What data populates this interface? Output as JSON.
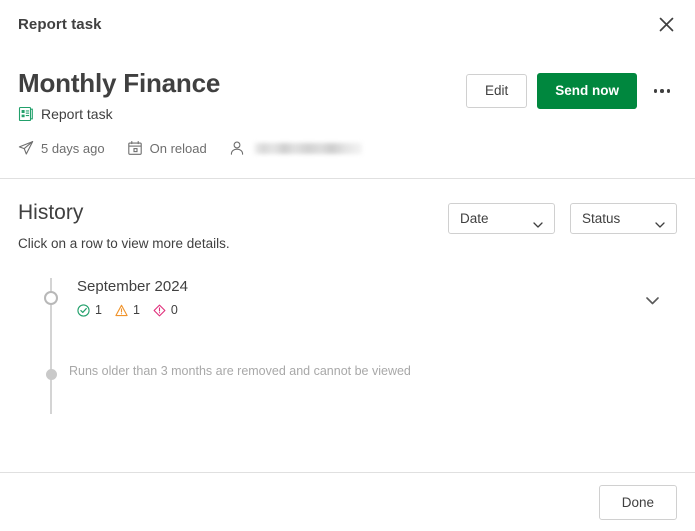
{
  "window": {
    "title": "Report task",
    "close_icon": "close-icon"
  },
  "header": {
    "title": "Monthly Finance",
    "subtitle": "Report task",
    "subtitle_icon": "report-task-icon",
    "meta": [
      {
        "icon": "send-icon",
        "label": "5 days ago"
      },
      {
        "icon": "calendar-icon",
        "label": "On reload"
      },
      {
        "icon": "person-icon",
        "label": ""
      }
    ],
    "actions": {
      "edit_label": "Edit",
      "send_now_label": "Send now",
      "more_icon": "more-options-icon"
    }
  },
  "history": {
    "title": "History",
    "description": "Click on a row to view more details.",
    "filters": [
      {
        "label": "Date",
        "icon": "chevron-down-icon"
      },
      {
        "label": "Status",
        "icon": "chevron-down-icon"
      }
    ],
    "rows": [
      {
        "date": "September 2024",
        "expand_icon": "chevron-down-icon",
        "stats": [
          {
            "icon": "success-icon",
            "value": "1"
          },
          {
            "icon": "warning-icon",
            "value": "1"
          },
          {
            "icon": "error-icon",
            "value": "0"
          }
        ]
      }
    ],
    "note": "Runs older than 3 months are removed and cannot be viewed"
  },
  "footer": {
    "done_label": "Done"
  },
  "colors": {
    "accent_green": "#00873e",
    "success": "#22a06b",
    "warning": "#f0932b",
    "error": "#e0317c",
    "text": "#404040",
    "muted": "#6e6e6e",
    "border": "#e0e0e0"
  }
}
